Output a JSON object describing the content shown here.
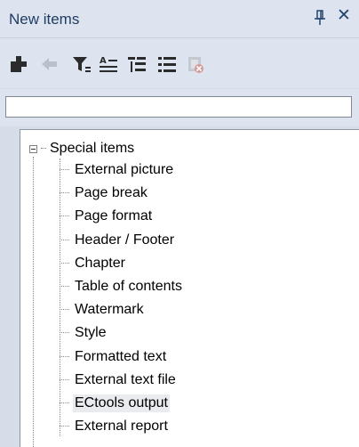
{
  "panel": {
    "title": "New items",
    "pin_icon": "pin-icon",
    "close_icon": "close-icon"
  },
  "toolbar": {
    "buttons": [
      {
        "name": "add-item-button",
        "icon": "plus-icon"
      },
      {
        "name": "back-button",
        "icon": "arrow-left-icon"
      },
      {
        "name": "filter-button",
        "icon": "filter-icon"
      },
      {
        "name": "sort-button",
        "icon": "sort-az-icon"
      },
      {
        "name": "tree-view-button",
        "icon": "tree-icon"
      },
      {
        "name": "list-view-button",
        "icon": "list-icon"
      },
      {
        "name": "delete-button",
        "icon": "delete-icon"
      }
    ]
  },
  "search": {
    "value": "",
    "placeholder": ""
  },
  "tree": {
    "root_label": "Special items",
    "items": [
      {
        "label": "External picture"
      },
      {
        "label": "Page break"
      },
      {
        "label": "Page format"
      },
      {
        "label": "Header / Footer"
      },
      {
        "label": "Chapter"
      },
      {
        "label": "Table of contents"
      },
      {
        "label": "Watermark"
      },
      {
        "label": "Style"
      },
      {
        "label": "Formatted text"
      },
      {
        "label": "External text file"
      },
      {
        "label": "ECtools output"
      },
      {
        "label": "External report"
      }
    ],
    "selected_index": 10
  }
}
